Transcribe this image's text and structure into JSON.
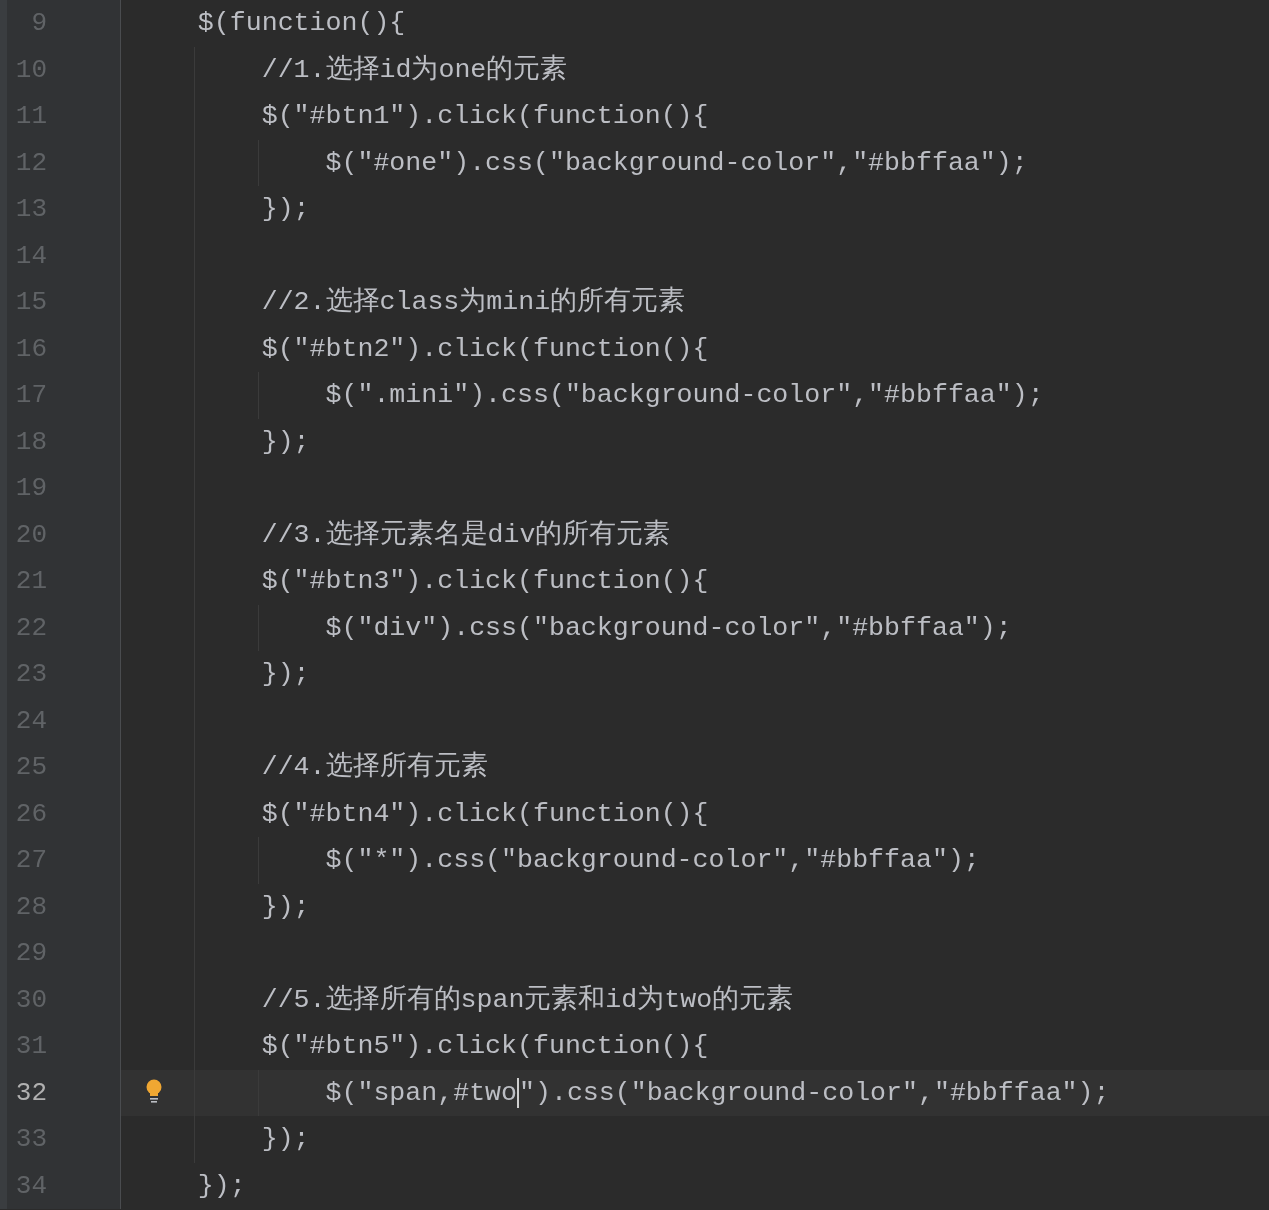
{
  "editor": {
    "lines": [
      {
        "number": "9",
        "text": "    $(function(){",
        "current": false,
        "intention_bulb": false,
        "caret": false
      },
      {
        "number": "10",
        "text": "        //1.选择id为one的元素",
        "current": false,
        "intention_bulb": false,
        "caret": false
      },
      {
        "number": "11",
        "text": "        $(\"#btn1\").click(function(){",
        "current": false,
        "intention_bulb": false,
        "caret": false
      },
      {
        "number": "12",
        "text": "            $(\"#one\").css(\"background-color\",\"#bbffaa\");",
        "current": false,
        "intention_bulb": false,
        "caret": false
      },
      {
        "number": "13",
        "text": "        });",
        "current": false,
        "intention_bulb": false,
        "caret": false
      },
      {
        "number": "14",
        "current": false,
        "intention_bulb": false,
        "caret": false
      },
      {
        "number": "15",
        "text": "        //2.选择class为mini的所有元素",
        "current": false,
        "intention_bulb": false,
        "caret": false
      },
      {
        "number": "16",
        "text": "        $(\"#btn2\").click(function(){",
        "current": false,
        "intention_bulb": false,
        "caret": false
      },
      {
        "number": "17",
        "text": "            $(\".mini\").css(\"background-color\",\"#bbffaa\");",
        "current": false,
        "intention_bulb": false,
        "caret": false
      },
      {
        "number": "18",
        "text": "        });",
        "current": false,
        "intention_bulb": false,
        "caret": false
      },
      {
        "number": "19",
        "current": false,
        "intention_bulb": false,
        "caret": false
      },
      {
        "number": "20",
        "text": "        //3.选择元素名是div的所有元素",
        "current": false,
        "intention_bulb": false,
        "caret": false
      },
      {
        "number": "21",
        "text": "        $(\"#btn3\").click(function(){",
        "current": false,
        "intention_bulb": false,
        "caret": false
      },
      {
        "number": "22",
        "text": "            $(\"div\").css(\"background-color\",\"#bbffaa\");",
        "current": false,
        "intention_bulb": false,
        "caret": false
      },
      {
        "number": "23",
        "text": "        });",
        "current": false,
        "intention_bulb": false,
        "caret": false
      },
      {
        "number": "24",
        "current": false,
        "intention_bulb": false,
        "caret": false
      },
      {
        "number": "25",
        "text": "        //4.选择所有元素",
        "current": false,
        "intention_bulb": false,
        "caret": false
      },
      {
        "number": "26",
        "text": "        $(\"#btn4\").click(function(){",
        "current": false,
        "intention_bulb": false,
        "caret": false
      },
      {
        "number": "27",
        "text": "            $(\"*\").css(\"background-color\",\"#bbffaa\");",
        "current": false,
        "intention_bulb": false,
        "caret": false
      },
      {
        "number": "28",
        "text": "        });",
        "current": false,
        "intention_bulb": false,
        "caret": false
      },
      {
        "number": "29",
        "current": false,
        "intention_bulb": false,
        "caret": false
      },
      {
        "number": "30",
        "text": "        //5.选择所有的span元素和id为two的元素",
        "current": false,
        "intention_bulb": false,
        "caret": false
      },
      {
        "number": "31",
        "text": "        $(\"#btn5\").click(function(){",
        "current": false,
        "intention_bulb": false,
        "caret": false
      },
      {
        "number": "32",
        "text": "            $(\"span,#two",
        "text_after_caret": "\").css(\"background-color\",\"#bbffaa\");",
        "current": true,
        "intention_bulb": true,
        "caret": true
      },
      {
        "number": "33",
        "text": "        });",
        "current": false,
        "intention_bulb": false,
        "caret": false
      },
      {
        "number": "34",
        "text": "    });",
        "current": false,
        "intention_bulb": false,
        "caret": false
      }
    ]
  }
}
